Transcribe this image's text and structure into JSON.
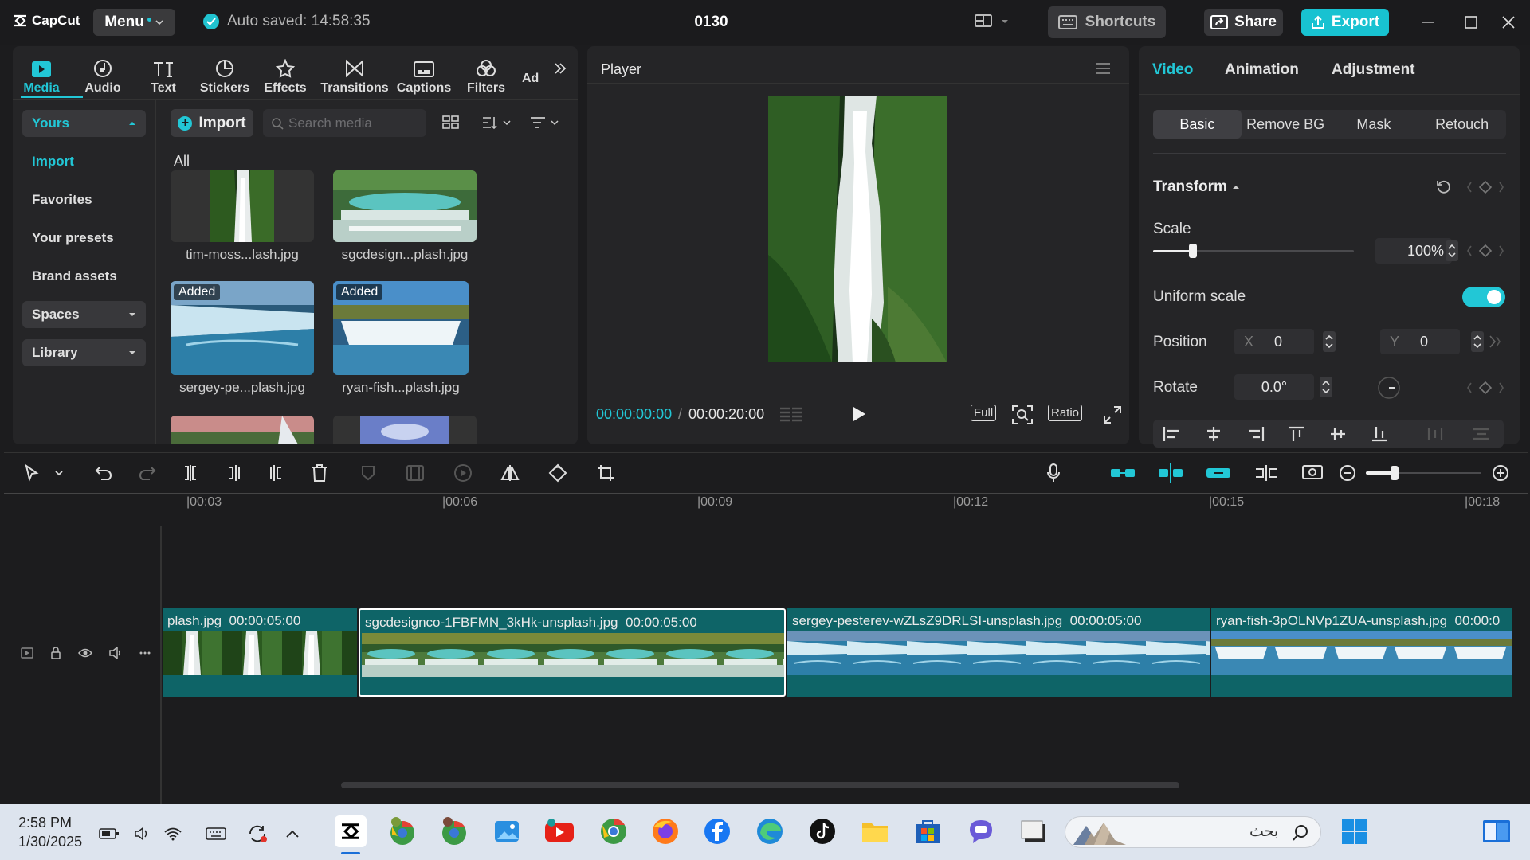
{
  "titlebar": {
    "logo": "CapCut",
    "menu": "Menu",
    "auto_saved": "Auto saved: 14:58:35",
    "project_name": "0130",
    "shortcuts": "Shortcuts",
    "share": "Share",
    "export": "Export"
  },
  "toolbar_tabs": [
    {
      "label": "Media",
      "icon": "media-icon"
    },
    {
      "label": "Audio",
      "icon": "audio-icon"
    },
    {
      "label": "Text",
      "icon": "text-icon"
    },
    {
      "label": "Stickers",
      "icon": "stickers-icon"
    },
    {
      "label": "Effects",
      "icon": "effects-icon"
    },
    {
      "label": "Transitions",
      "icon": "transitions-icon"
    },
    {
      "label": "Captions",
      "icon": "captions-icon"
    },
    {
      "label": "Filters",
      "icon": "filters-icon"
    },
    {
      "label": "Ad",
      "icon": "adjust-icon"
    }
  ],
  "sidebar": {
    "yours": "Yours",
    "import": "Import",
    "favorites": "Favorites",
    "your_presets": "Your presets",
    "brand_assets": "Brand assets",
    "spaces": "Spaces",
    "library": "Library"
  },
  "media": {
    "import_button": "Import",
    "search_placeholder": "Search media",
    "category": "All",
    "added_badge": "Added",
    "items": [
      {
        "name": "tim-moss...lash.jpg"
      },
      {
        "name": "sgcdesign...plash.jpg"
      },
      {
        "name": "sergey-pe...plash.jpg"
      },
      {
        "name": "ryan-fish...plash.jpg"
      }
    ]
  },
  "player": {
    "title": "Player",
    "current_time": "00:00:00:00",
    "separator": "/",
    "duration": "00:00:20:00",
    "full": "Full",
    "ratio": "Ratio"
  },
  "properties": {
    "tabs": [
      "Video",
      "Animation",
      "Adjustment"
    ],
    "subtabs": [
      "Basic",
      "Remove BG",
      "Mask",
      "Retouch"
    ],
    "transform": "Transform",
    "scale_label": "Scale",
    "scale_value": "100%",
    "scale_fraction": 0.2,
    "uniform_scale": "Uniform scale",
    "uniform_scale_on": true,
    "position_label": "Position",
    "x_label": "X",
    "x_value": "0",
    "y_label": "Y",
    "y_value": "0",
    "rotate_label": "Rotate",
    "rotate_value": "0.0°"
  },
  "timeline": {
    "ruler": [
      "|00:03",
      "|00:06",
      "|00:09",
      "|00:12",
      "|00:15",
      "|00:18"
    ],
    "zoom_fraction": 0.25,
    "clips": [
      {
        "name": "plash.jpg",
        "duration": "00:00:05:00"
      },
      {
        "name": "sgcdesignco-1FBFMN_3kHk-unsplash.jpg",
        "duration": "00:00:05:00"
      },
      {
        "name": "sergey-pesterev-wZLsZ9DRLSI-unsplash.jpg",
        "duration": "00:00:05:00"
      },
      {
        "name": "ryan-fish-3pOLNVp1ZUA-unsplash.jpg",
        "duration": "00:00:0"
      }
    ]
  },
  "taskbar": {
    "time": "2:58 PM",
    "date": "1/30/2025",
    "search_text": "بحث"
  },
  "colors": {
    "accent": "#22c7d6",
    "clip": "#0e6467",
    "background": "#1c1c1e"
  }
}
